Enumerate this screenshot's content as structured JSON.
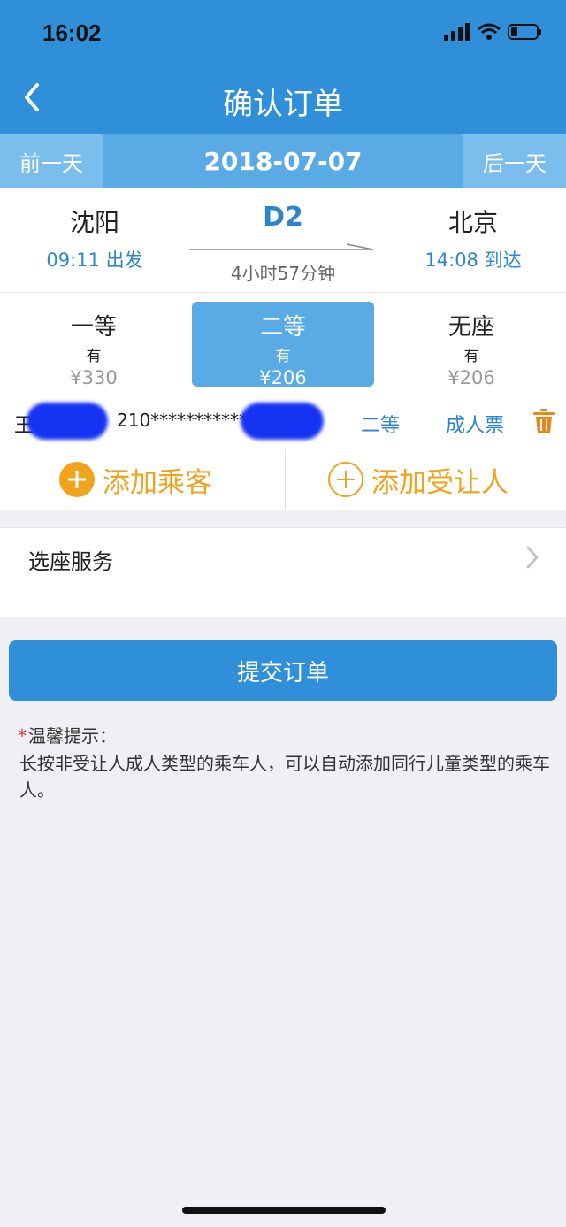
{
  "status_bar": {
    "time": "16:02"
  },
  "nav": {
    "title": "确认订单"
  },
  "date_bar": {
    "prev": "前一天",
    "current": "2018-07-07",
    "next": "后一天"
  },
  "train": {
    "from_station": "沈阳",
    "depart": "09:11 出发",
    "number": "D2",
    "duration": "4小时57分钟",
    "to_station": "北京",
    "arrive": "14:08 到达"
  },
  "seats": [
    {
      "name": "一等",
      "availability": "有",
      "price": "¥330"
    },
    {
      "name": "二等",
      "availability": "有",
      "price": "¥206",
      "selected": true
    },
    {
      "name": "无座",
      "availability": "有",
      "price": "¥206"
    }
  ],
  "passenger": {
    "name": "王",
    "id": "210***********",
    "seat_class": "二等",
    "ticket_type": "成人票"
  },
  "actions": {
    "add_passenger": "添加乘客",
    "add_concession": "添加受让人"
  },
  "seat_service": {
    "label": "选座服务"
  },
  "submit": {
    "label": "提交订单"
  },
  "tip": {
    "star": "*",
    "title": "温馨提示：",
    "body": "长按非受让人成人类型的乘车人，可以自动添加同行儿童类型的乘车人。"
  },
  "colors": {
    "primary": "#2f8fd8",
    "date_bar": "#5aaae6",
    "accent": "#f0a31c",
    "link": "#2d86c9"
  }
}
